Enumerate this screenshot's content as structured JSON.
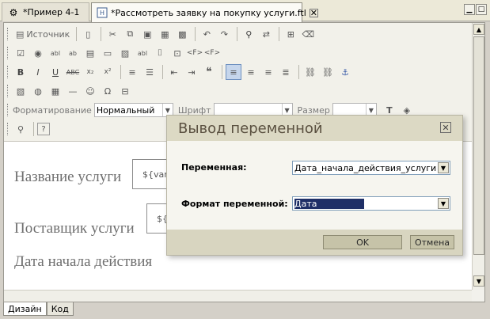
{
  "tabs": [
    {
      "label": "*Пример 4-1",
      "icon": "gear-icon"
    },
    {
      "label": "*Рассмотреть заявку на покупку услуги.ftl",
      "icon": "html-file-icon"
    }
  ],
  "toolbar": {
    "source_label": "Источник",
    "format_label": "Форматирование",
    "format_value": "Нормальный",
    "font_label": "Шрифт",
    "font_value": "",
    "size_label": "Размер",
    "size_value": ""
  },
  "content": {
    "field1_label": "Название услуги",
    "field1_var": "${vari",
    "field2_label": "Поставщик услуги",
    "field2_var": "${v",
    "field3_label": "Дата начала действия"
  },
  "bottom_tabs": [
    "Дизайн",
    "Код"
  ],
  "dialog": {
    "title": "Вывод переменной",
    "variable_label": "Переменная:",
    "variable_value": "Дата_начала_действия_услуги",
    "format_label": "Формат переменной:",
    "format_value": "Дата",
    "ok_label": "OK",
    "cancel_label": "Отмена"
  }
}
